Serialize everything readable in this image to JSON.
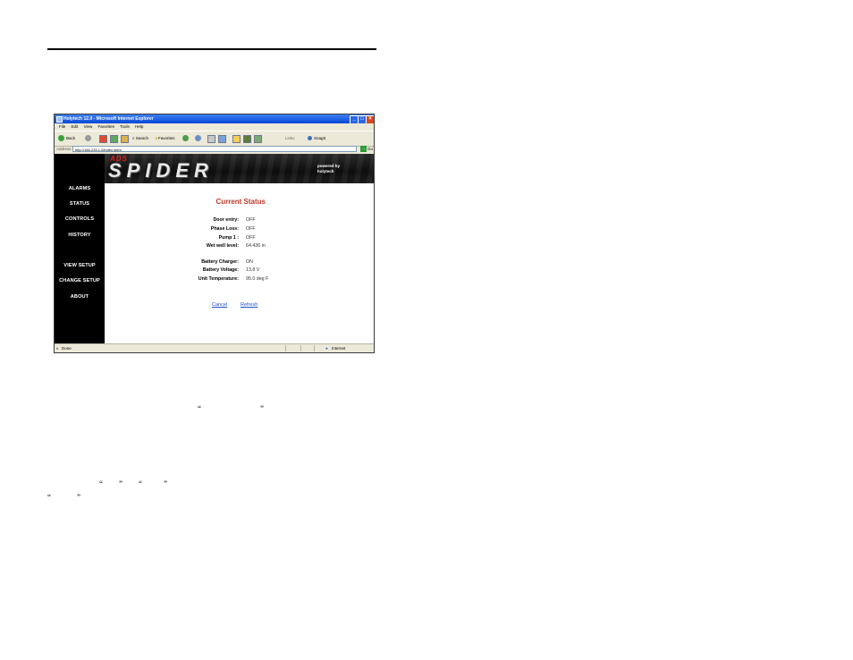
{
  "window": {
    "title": "Holytech 12.0 - Microsoft Internet Explorer",
    "menu": [
      "File",
      "Edit",
      "View",
      "Favorites",
      "Tools",
      "Help"
    ],
    "toolbar": {
      "back": "Back",
      "search": "Search",
      "favorites": "Favorites",
      "links": "Links",
      "snagit": "SnagIt"
    },
    "address_label": "Address",
    "address_url": "http://166-239.1.0/index.shtm",
    "go_label": "Go",
    "status_left": "Done",
    "status_zone": "Internet"
  },
  "banner": {
    "brand_top": "ADS",
    "brand_main": "SPIDER",
    "powered_line1": "powered by",
    "powered_line2": "holytech"
  },
  "nav": {
    "items": [
      "ALARMS",
      "STATUS",
      "CONTROLS",
      "HISTORY",
      "VIEW SETUP",
      "CHANGE SETUP",
      "ABOUT"
    ]
  },
  "status": {
    "title": "Current Status",
    "rows": [
      {
        "label": "Door entry:",
        "value": "OFF"
      },
      {
        "label": "Phase Loss:",
        "value": "OFF"
      },
      {
        "label": "Pump 1 :",
        "value": "OFF"
      },
      {
        "label": "Wet well level:",
        "value": "64.436 in"
      },
      {
        "label": "Battery Charger:",
        "value": "ON"
      },
      {
        "label": "Battery Voltage:",
        "value": "13.8 V"
      },
      {
        "label": "Unit Temperature:",
        "value": "95.0 deg F"
      }
    ],
    "cancel_label": "Cancel",
    "refresh_label": "Refresh"
  },
  "quotes": {
    "open": "“",
    "close": "”"
  }
}
